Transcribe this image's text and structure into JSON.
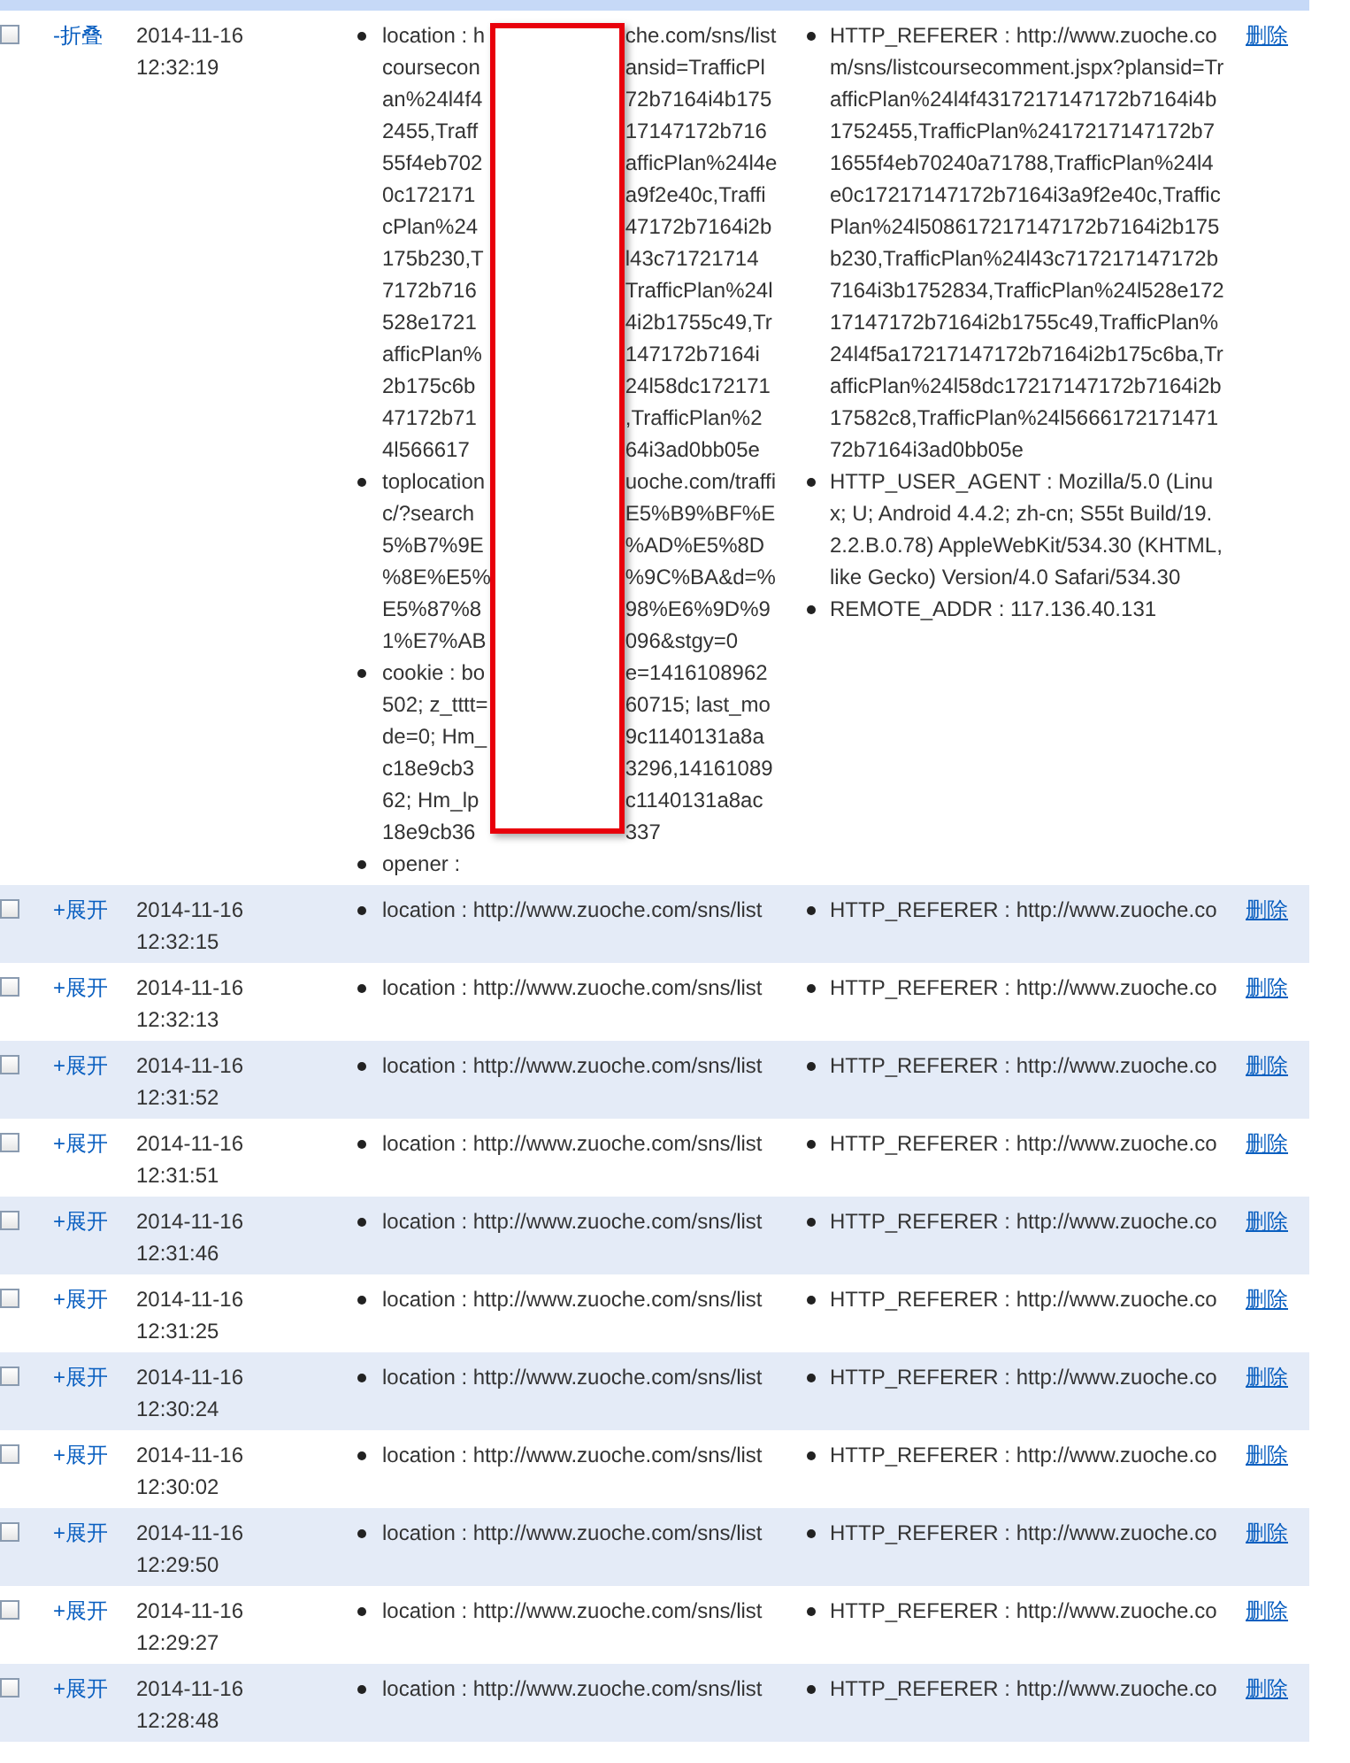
{
  "rows": [
    {
      "checked": false,
      "toggle": "-折叠",
      "date": "2014-11-16",
      "time": "12:32:19",
      "request": [
        {
          "lines": [
            [
              "location : h",
              "che.com/sns/list"
            ],
            [
              "coursecon",
              "ansid=TrafficPl"
            ],
            [
              "an%24l4f4",
              "72b7164i4b175"
            ],
            [
              "2455,Traff",
              "17147172b716"
            ],
            [
              "55f4eb702",
              "afficPlan%24l4e"
            ],
            [
              "0c172171",
              "a9f2e40c,Traffi"
            ],
            [
              "cPlan%24",
              "47172b7164i2b"
            ],
            [
              "175b230,T",
              "l43c71721714"
            ],
            [
              "7172b716",
              "TrafficPlan%24l"
            ],
            [
              "528e1721",
              "4i2b1755c49,Tr"
            ],
            [
              "afficPlan%",
              "147172b7164i"
            ],
            [
              "2b175c6b",
              "24l58dc172171"
            ],
            [
              "47172b71",
              ",TrafficPlan%2"
            ],
            [
              "4l566617",
              "64i3ad0bb05e"
            ]
          ]
        },
        {
          "lines": [
            [
              "toplocation",
              "uoche.com/traffi"
            ],
            [
              "c/?search",
              "E5%B9%BF%E"
            ],
            [
              "5%B7%9E",
              "%AD%E5%8D"
            ],
            [
              "%8E%E5%",
              "%9C%BA&d=%"
            ],
            [
              "E5%87%8",
              "98%E6%9D%9"
            ],
            [
              "1%E7%AB",
              "096&stgy=0"
            ]
          ]
        },
        {
          "lines": [
            [
              "cookie : bo",
              "e=1416108962"
            ],
            [
              "502; z_tttt=",
              "60715; last_mo"
            ],
            [
              "de=0; Hm_",
              "9c1140131a8a"
            ],
            [
              "c18e9cb3",
              "3296,14161089"
            ],
            [
              "62; Hm_lp",
              "c1140131a8ac"
            ],
            [
              "18e9cb36",
              "337"
            ]
          ]
        },
        {
          "lines": [
            [
              "opener :"
            ]
          ]
        }
      ],
      "server": [
        "HTTP_REFERER : http://www.zuoche.com/sns/listcoursecomment.jspx?plansid=TrafficPlan%24l4f4317217147172b7164i4b1752455,TrafficPlan%2417217147172b71655f4eb70240a71788,TrafficPlan%24l4e0c17217147172b7164i3a9f2e40c,TrafficPlan%24l508617217147172b7164i2b175b230,TrafficPlan%24l43c717217147172b7164i3b1752834,TrafficPlan%24l528e17217147172b7164i2b1755c49,TrafficPlan%24l4f5a17217147172b7164i2b175c6ba,TrafficPlan%24l58dc17217147172b7164i2b17582c8,TrafficPlan%24l566617217147172b7164i3ad0bb05e",
        "HTTP_USER_AGENT : Mozilla/5.0 (Linux; U; Android 4.4.2; zh-cn; S55t Build/19.2.2.B.0.78) AppleWebKit/534.30 (KHTML, like Gecko) Version/4.0 Safari/534.30",
        "REMOTE_ADDR : 117.136.40.131"
      ],
      "action": "删除"
    },
    {
      "checked": false,
      "toggle": "+展开",
      "date": "2014-11-16",
      "time": "12:32:15",
      "request": [
        {
          "lines": [
            [
              "location : http://www.zuoche.com/sns/list"
            ]
          ]
        }
      ],
      "server": [
        "HTTP_REFERER : http://www.zuoche.co"
      ],
      "action": "删除"
    },
    {
      "checked": false,
      "toggle": "+展开",
      "date": "2014-11-16",
      "time": "12:32:13",
      "request": [
        {
          "lines": [
            [
              "location : http://www.zuoche.com/sns/list"
            ]
          ]
        }
      ],
      "server": [
        "HTTP_REFERER : http://www.zuoche.co"
      ],
      "action": "删除"
    },
    {
      "checked": false,
      "toggle": "+展开",
      "date": "2014-11-16",
      "time": "12:31:52",
      "request": [
        {
          "lines": [
            [
              "location : http://www.zuoche.com/sns/list"
            ]
          ]
        }
      ],
      "server": [
        "HTTP_REFERER : http://www.zuoche.co"
      ],
      "action": "删除"
    },
    {
      "checked": false,
      "toggle": "+展开",
      "date": "2014-11-16",
      "time": "12:31:51",
      "request": [
        {
          "lines": [
            [
              "location : http://www.zuoche.com/sns/list"
            ]
          ]
        }
      ],
      "server": [
        "HTTP_REFERER : http://www.zuoche.co"
      ],
      "action": "删除"
    },
    {
      "checked": false,
      "toggle": "+展开",
      "date": "2014-11-16",
      "time": "12:31:46",
      "request": [
        {
          "lines": [
            [
              "location : http://www.zuoche.com/sns/list"
            ]
          ]
        }
      ],
      "server": [
        "HTTP_REFERER : http://www.zuoche.co"
      ],
      "action": "删除"
    },
    {
      "checked": false,
      "toggle": "+展开",
      "date": "2014-11-16",
      "time": "12:31:25",
      "request": [
        {
          "lines": [
            [
              "location : http://www.zuoche.com/sns/list"
            ]
          ]
        }
      ],
      "server": [
        "HTTP_REFERER : http://www.zuoche.co"
      ],
      "action": "删除"
    },
    {
      "checked": false,
      "toggle": "+展开",
      "date": "2014-11-16",
      "time": "12:30:24",
      "request": [
        {
          "lines": [
            [
              "location : http://www.zuoche.com/sns/list"
            ]
          ]
        }
      ],
      "server": [
        "HTTP_REFERER : http://www.zuoche.co"
      ],
      "action": "删除"
    },
    {
      "checked": false,
      "toggle": "+展开",
      "date": "2014-11-16",
      "time": "12:30:02",
      "request": [
        {
          "lines": [
            [
              "location : http://www.zuoche.com/sns/list"
            ]
          ]
        }
      ],
      "server": [
        "HTTP_REFERER : http://www.zuoche.co"
      ],
      "action": "删除"
    },
    {
      "checked": false,
      "toggle": "+展开",
      "date": "2014-11-16",
      "time": "12:29:50",
      "request": [
        {
          "lines": [
            [
              "location : http://www.zuoche.com/sns/list"
            ]
          ]
        }
      ],
      "server": [
        "HTTP_REFERER : http://www.zuoche.co"
      ],
      "action": "删除"
    },
    {
      "checked": false,
      "toggle": "+展开",
      "date": "2014-11-16",
      "time": "12:29:27",
      "request": [
        {
          "lines": [
            [
              "location : http://www.zuoche.com/sns/list"
            ]
          ]
        }
      ],
      "server": [
        "HTTP_REFERER : http://www.zuoche.co"
      ],
      "action": "删除"
    },
    {
      "checked": false,
      "toggle": "+展开",
      "date": "2014-11-16",
      "time": "12:28:48",
      "request": [
        {
          "lines": [
            [
              "location : http://www.zuoche.com/sns/list"
            ]
          ]
        }
      ],
      "server": [
        "HTTP_REFERER : http://www.zuoche.co"
      ],
      "action": "删除"
    }
  ]
}
